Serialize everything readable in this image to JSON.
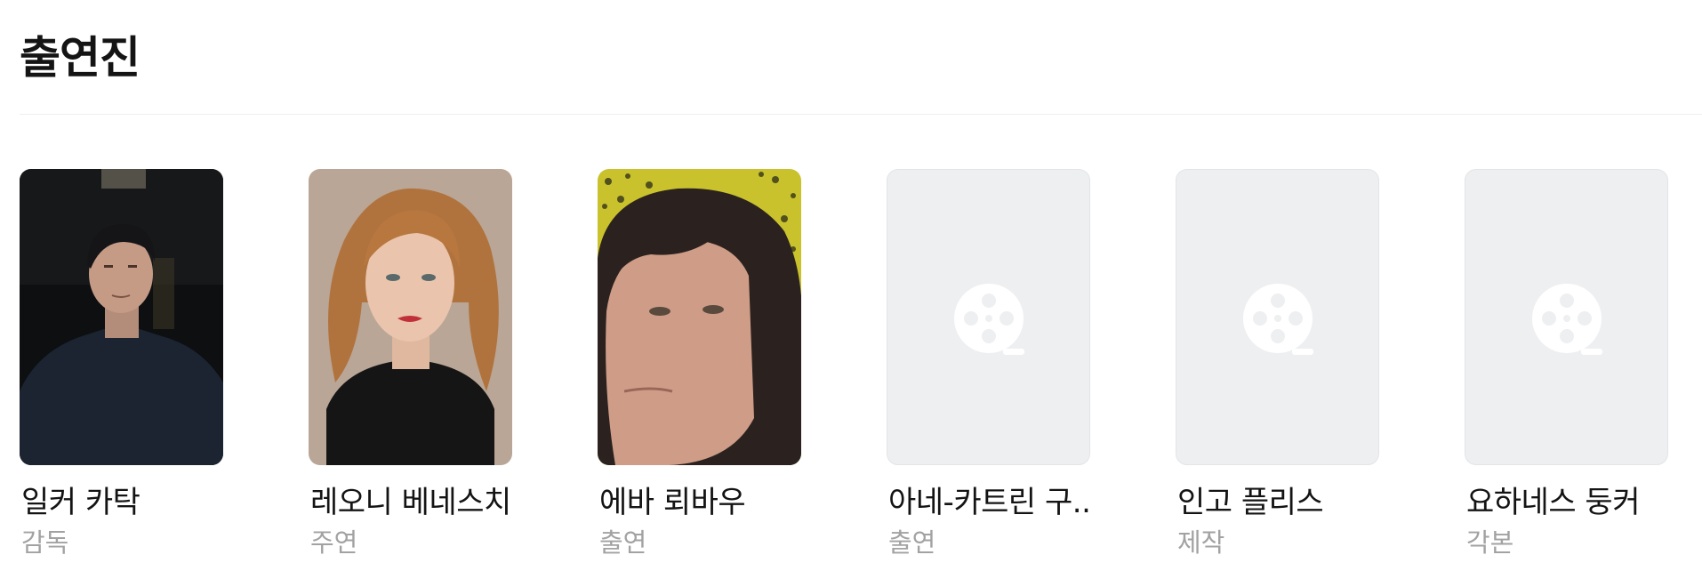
{
  "section": {
    "title": "출연진"
  },
  "cast": [
    {
      "name": "일커 카탁",
      "role": "감독",
      "photo": "director-portrait-dark-background"
    },
    {
      "name": "레오니 베네스치",
      "role": "주연",
      "photo": "actress-portrait-red-hair"
    },
    {
      "name": "에바 뢰바우",
      "role": "출연",
      "photo": "actress-portrait-yellow-background"
    },
    {
      "name": "아네-카트린 구...",
      "role": "출연",
      "photo": "film-reel-icon"
    },
    {
      "name": "인고 플리스",
      "role": "제작",
      "photo": "film-reel-icon"
    },
    {
      "name": "요하네스 둥커",
      "role": "각본",
      "photo": "film-reel-icon"
    }
  ],
  "colors": {
    "placeholder_bg": "#eeeff1",
    "placeholder_icon": "#ffffff",
    "role_text": "#a2a2a2",
    "name_text": "#141414"
  }
}
